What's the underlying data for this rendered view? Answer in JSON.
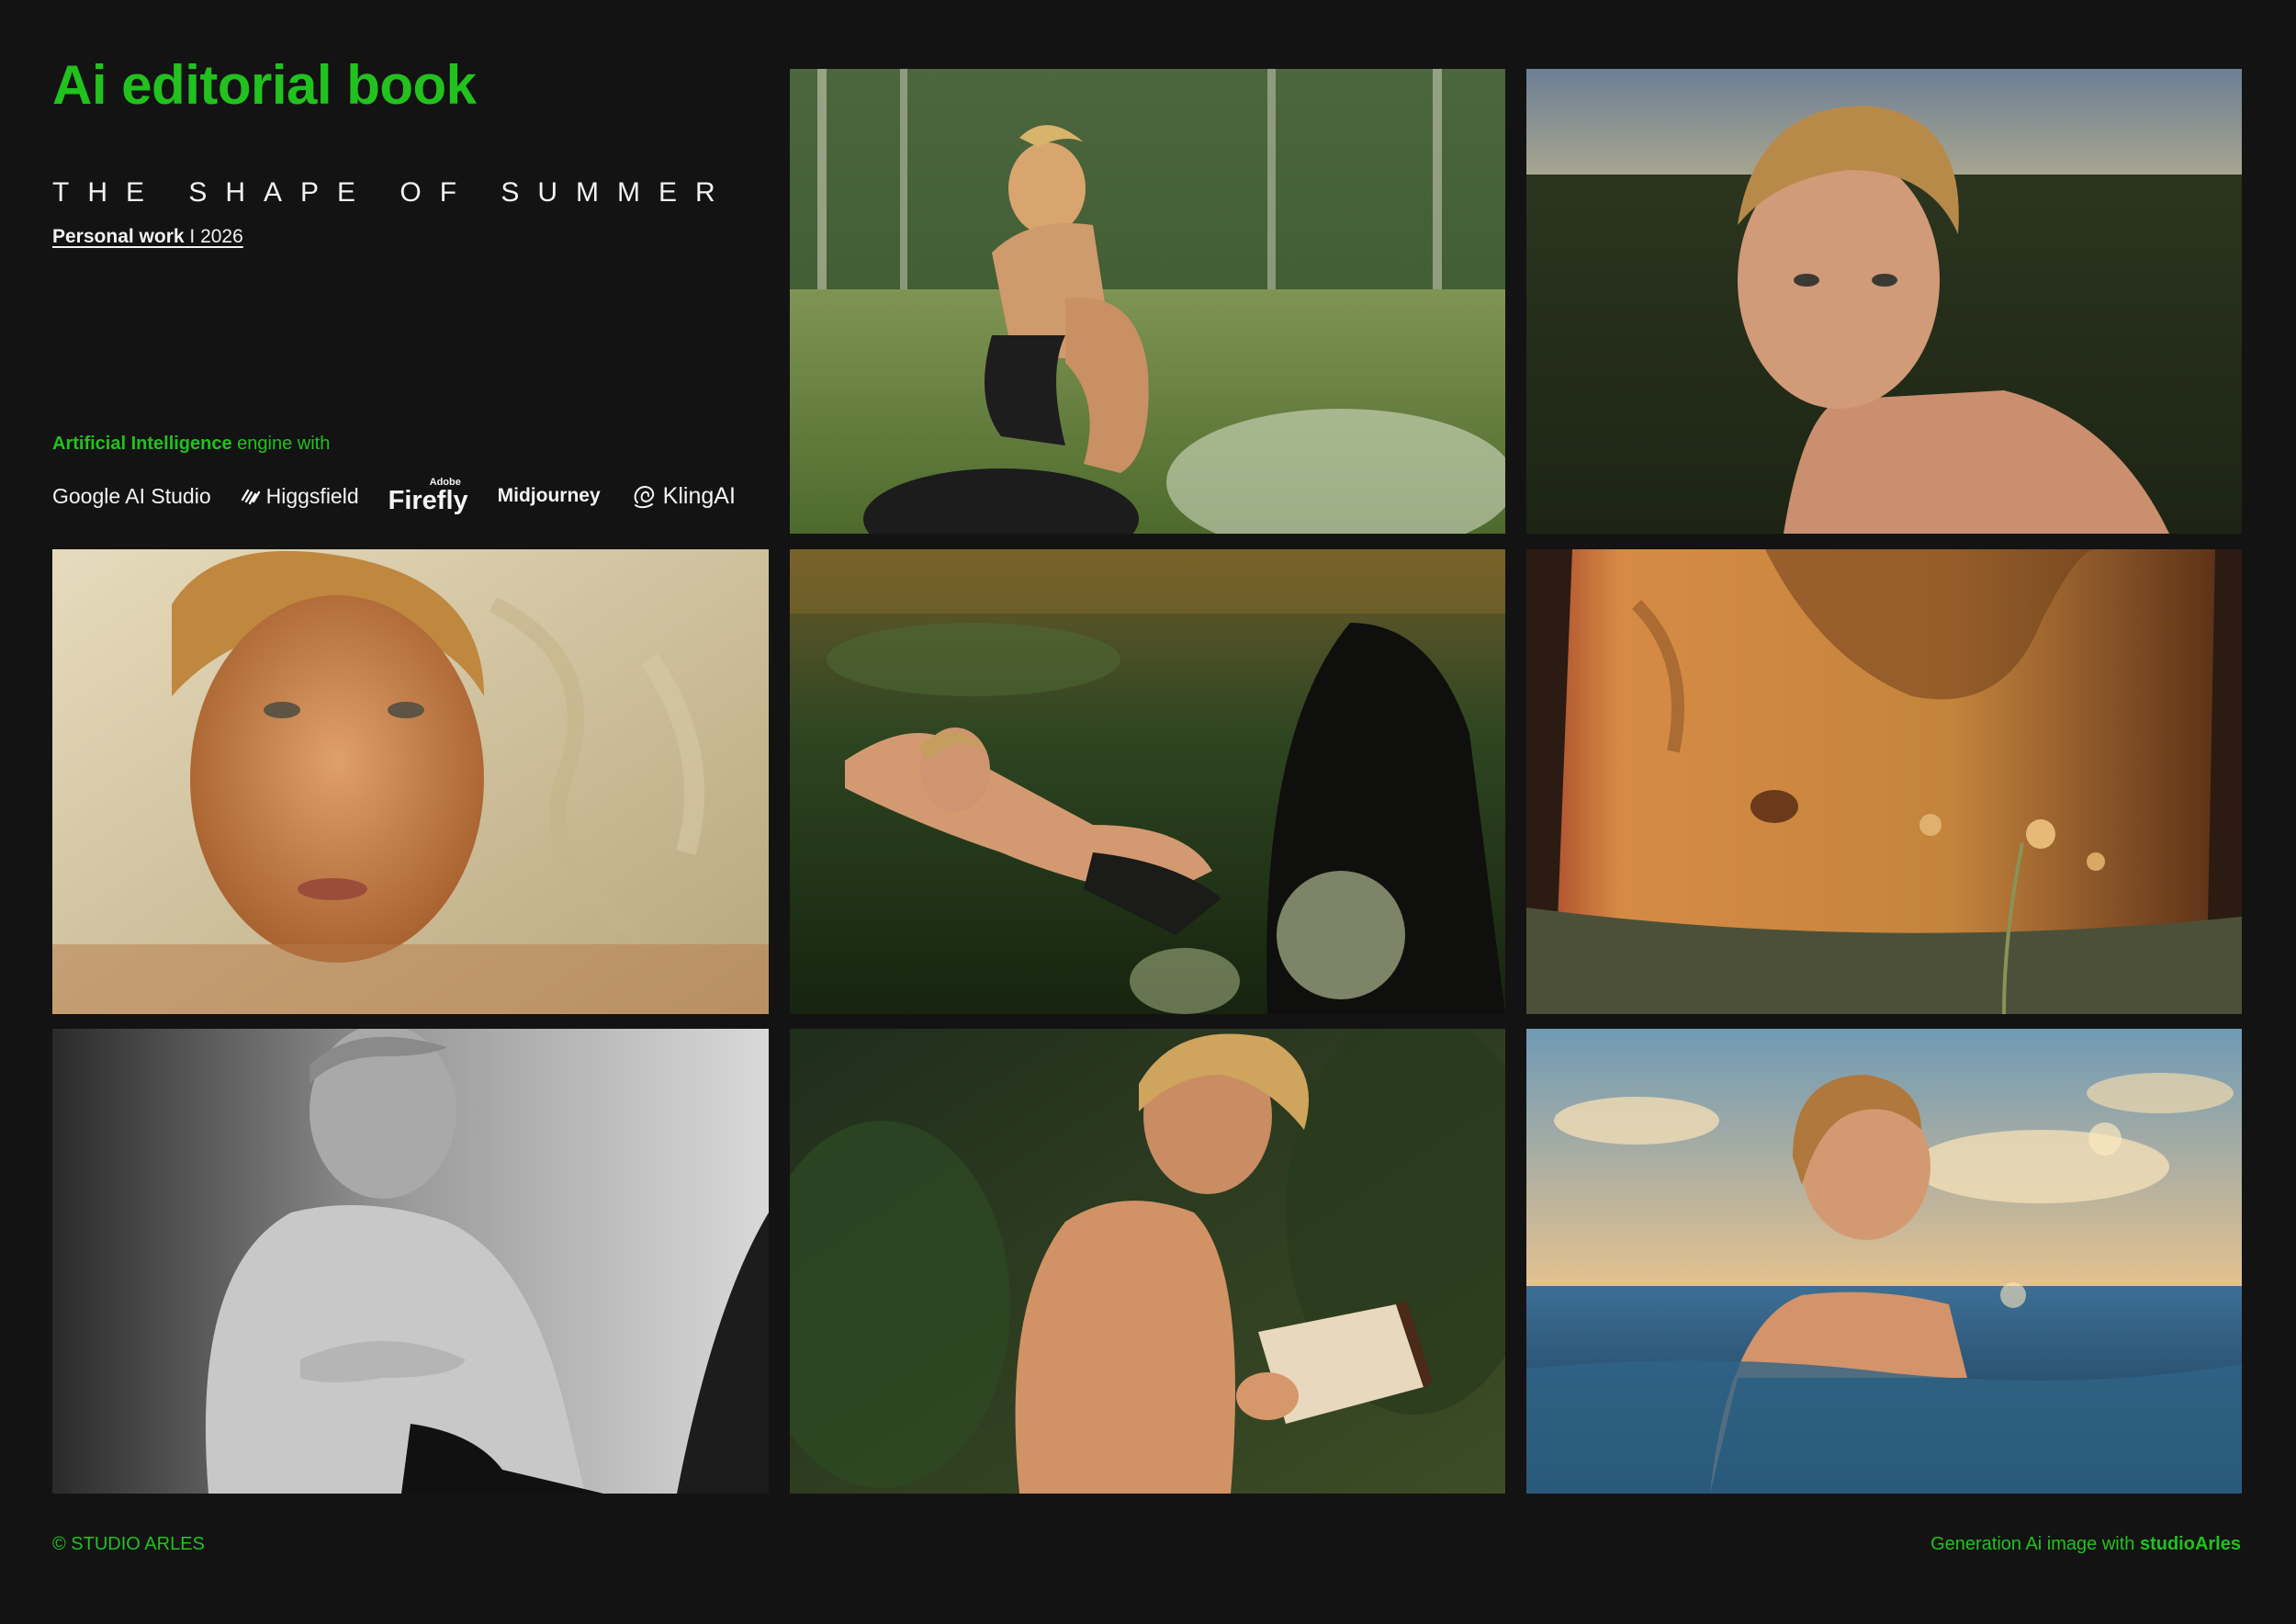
{
  "header": {
    "title": "Ai editorial book",
    "series_title": "THE SHAPE OF SUMMER",
    "byline_strong": "Personal work",
    "byline_rest": " I 2026"
  },
  "engines": {
    "intro_strong": "Artificial Intelligence",
    "intro_rest": " engine with",
    "tools": {
      "google": "Google AI Studio",
      "higgsfield": "Higgsfield",
      "firefly_sub": "Adobe",
      "firefly": "Firefly",
      "midjourney": "Midjourney",
      "kling": "KlingAI"
    }
  },
  "photos": [
    "boy-crouching-on-rock-in-meadow",
    "portrait-in-dark-field-at-dusk",
    "face-on-cream-bedsheets",
    "reclining-in-flowering-grass",
    "torso-with-shadow-and-wildflower",
    "black-and-white-seated-torso",
    "writing-in-notebook-in-forest",
    "swimming-in-sea-at-sunset"
  ],
  "footer": {
    "copyright": "© STUDIO ARLES",
    "credit_prefix": "Generation Ai image with ",
    "credit_strong": "studioArles"
  },
  "colors": {
    "background": "#131313",
    "accent": "#22c21e",
    "text": "#f2f2f2"
  }
}
